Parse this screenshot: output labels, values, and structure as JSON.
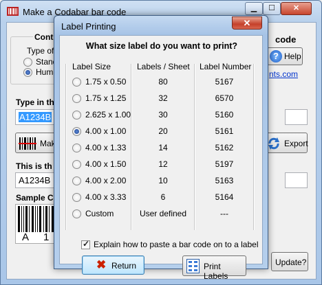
{
  "main": {
    "title": "Make a Codabar bar code",
    "controls_group_title": "Contro",
    "type_label": "Type of",
    "radio_standard": "Stand",
    "radio_human": "Huma",
    "code_title": "code",
    "help_label": "Help",
    "link_text": "nts.com",
    "typein_label": "Type in th",
    "typein_value": "A1234B",
    "make_label": "Mak",
    "export_label": "Export",
    "thisis_label": "This is th",
    "barcode_value": "A1234B",
    "sample_label": "Sample Co",
    "sample_chars": [
      "A",
      "1"
    ],
    "update_label": "Update?"
  },
  "dialog": {
    "title": "Label Printing",
    "question": "What size label do you want to print?",
    "headers": {
      "size": "Label Size",
      "per_sheet": "Labels / Sheet",
      "number": "Label Number"
    },
    "rows": [
      {
        "size": "1.75 x 0.50",
        "per_sheet": "80",
        "number": "5167",
        "selected": false
      },
      {
        "size": "1.75 x 1.25",
        "per_sheet": "32",
        "number": "6570",
        "selected": false
      },
      {
        "size": "2.625 x 1.00",
        "per_sheet": "30",
        "number": "5160",
        "selected": false
      },
      {
        "size": "4.00 x 1.00",
        "per_sheet": "20",
        "number": "5161",
        "selected": true
      },
      {
        "size": "4.00 x 1.33",
        "per_sheet": "14",
        "number": "5162",
        "selected": false
      },
      {
        "size": "4.00 x 1.50",
        "per_sheet": "12",
        "number": "5197",
        "selected": false
      },
      {
        "size": "4.00 x 2.00",
        "per_sheet": "10",
        "number": "5163",
        "selected": false
      },
      {
        "size": "4.00 x 3.33",
        "per_sheet": "6",
        "number": "5164",
        "selected": false
      },
      {
        "size": "Custom",
        "per_sheet": "User defined",
        "number": "---",
        "selected": false
      }
    ],
    "explain_checkbox": "Explain how to paste a bar code on to a label",
    "explain_checked": true,
    "return_label": "Return",
    "print_label": "Print Labels"
  },
  "colors": {
    "accent": "#3c7fb1",
    "selection": "#3399ff",
    "close": "#c7452d",
    "return_x": "#cc2200"
  }
}
